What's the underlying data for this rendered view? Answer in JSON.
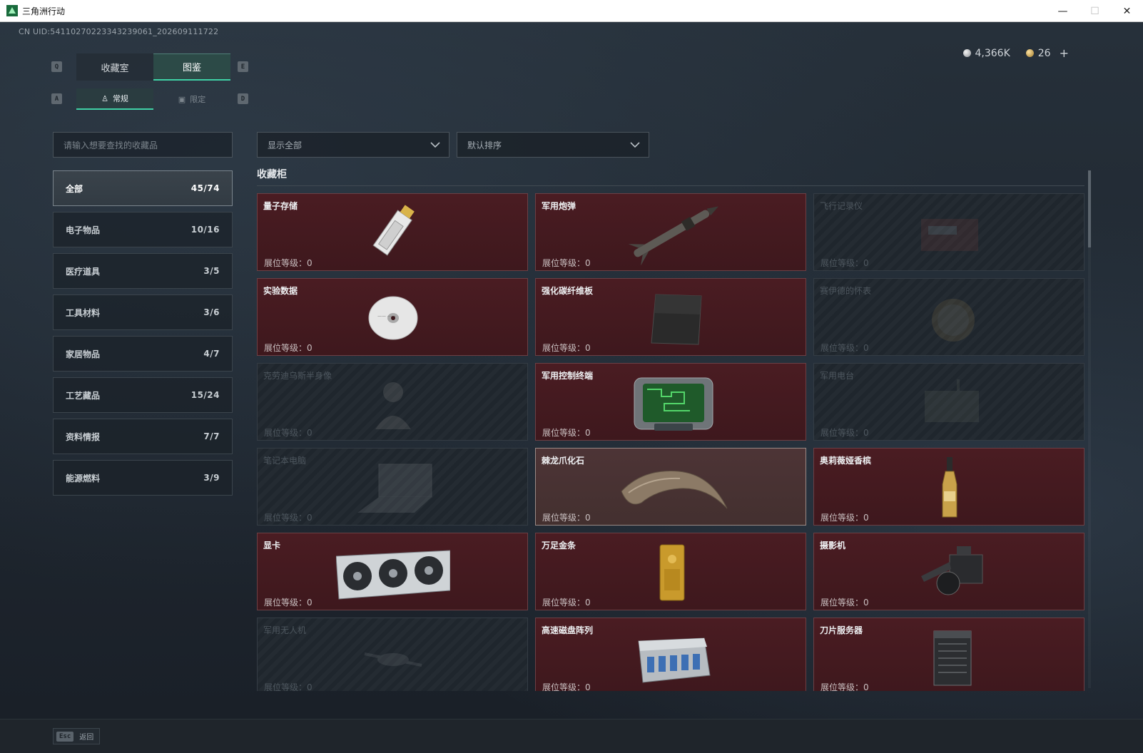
{
  "window": {
    "title": "三角洲行动",
    "minimize": "—",
    "maximize": "☐",
    "close": "✕"
  },
  "uid": "CN UID:54110270223343239061_202609111722",
  "currency": {
    "silver": "4,366K",
    "gold": "26",
    "add": "+"
  },
  "top_tabs": {
    "key_left": "Q",
    "key_right": "E",
    "items": [
      {
        "label": "收藏室",
        "active": false
      },
      {
        "label": "图鉴",
        "active": true
      }
    ]
  },
  "sub_tabs": {
    "key_left": "A",
    "key_right": "D",
    "items": [
      {
        "label": "常规",
        "icon": "figure-icon",
        "active": true
      },
      {
        "label": "限定",
        "icon": "card-icon",
        "active": false
      }
    ]
  },
  "search": {
    "placeholder": "请输入想要查找的收藏品"
  },
  "filters": {
    "show": "显示全部",
    "sort": "默认排序"
  },
  "categories": [
    {
      "label": "全部",
      "count": "45/74",
      "active": true
    },
    {
      "label": "电子物品",
      "count": "10/16",
      "active": false
    },
    {
      "label": "医疗道具",
      "count": "3/5",
      "active": false
    },
    {
      "label": "工具材料",
      "count": "3/6",
      "active": false
    },
    {
      "label": "家居物品",
      "count": "4/7",
      "active": false
    },
    {
      "label": "工艺藏品",
      "count": "15/24",
      "active": false
    },
    {
      "label": "资料情报",
      "count": "7/7",
      "active": false
    },
    {
      "label": "能源燃料",
      "count": "3/9",
      "active": false
    }
  ],
  "section_title": "收藏柜",
  "level_label": "展位等级：0",
  "items": [
    {
      "name": "量子存储",
      "unlocked": true,
      "icon": "usb-stick-icon"
    },
    {
      "name": "军用炮弹",
      "unlocked": true,
      "icon": "missile-icon"
    },
    {
      "name": "飞行记录仪",
      "unlocked": false,
      "icon": "flight-recorder-icon"
    },
    {
      "name": "实验数据",
      "unlocked": true,
      "icon": "disc-icon"
    },
    {
      "name": "强化碳纤维板",
      "unlocked": true,
      "icon": "carbon-plate-icon"
    },
    {
      "name": "赛伊德的怀表",
      "unlocked": false,
      "icon": "pocket-watch-icon"
    },
    {
      "name": "克劳迪乌斯半身像",
      "unlocked": false,
      "icon": "bust-icon"
    },
    {
      "name": "军用控制终端",
      "unlocked": true,
      "icon": "control-terminal-icon"
    },
    {
      "name": "军用电台",
      "unlocked": false,
      "icon": "radio-icon"
    },
    {
      "name": "笔记本电脑",
      "unlocked": false,
      "icon": "laptop-icon"
    },
    {
      "name": "棘龙爪化石",
      "unlocked": true,
      "highlight": true,
      "icon": "claw-fossil-icon"
    },
    {
      "name": "奥莉薇娅香槟",
      "unlocked": true,
      "icon": "champagne-icon"
    },
    {
      "name": "显卡",
      "unlocked": true,
      "icon": "graphics-card-icon"
    },
    {
      "name": "万足金条",
      "unlocked": true,
      "icon": "gold-bar-icon"
    },
    {
      "name": "摄影机",
      "unlocked": true,
      "icon": "camera-icon"
    },
    {
      "name": "军用无人机",
      "unlocked": false,
      "icon": "drone-icon"
    },
    {
      "name": "高速磁盘阵列",
      "unlocked": true,
      "icon": "disk-array-icon"
    },
    {
      "name": "刀片服务器",
      "unlocked": true,
      "icon": "blade-server-icon"
    }
  ],
  "footer": {
    "key": "Esc",
    "label": "返回"
  }
}
